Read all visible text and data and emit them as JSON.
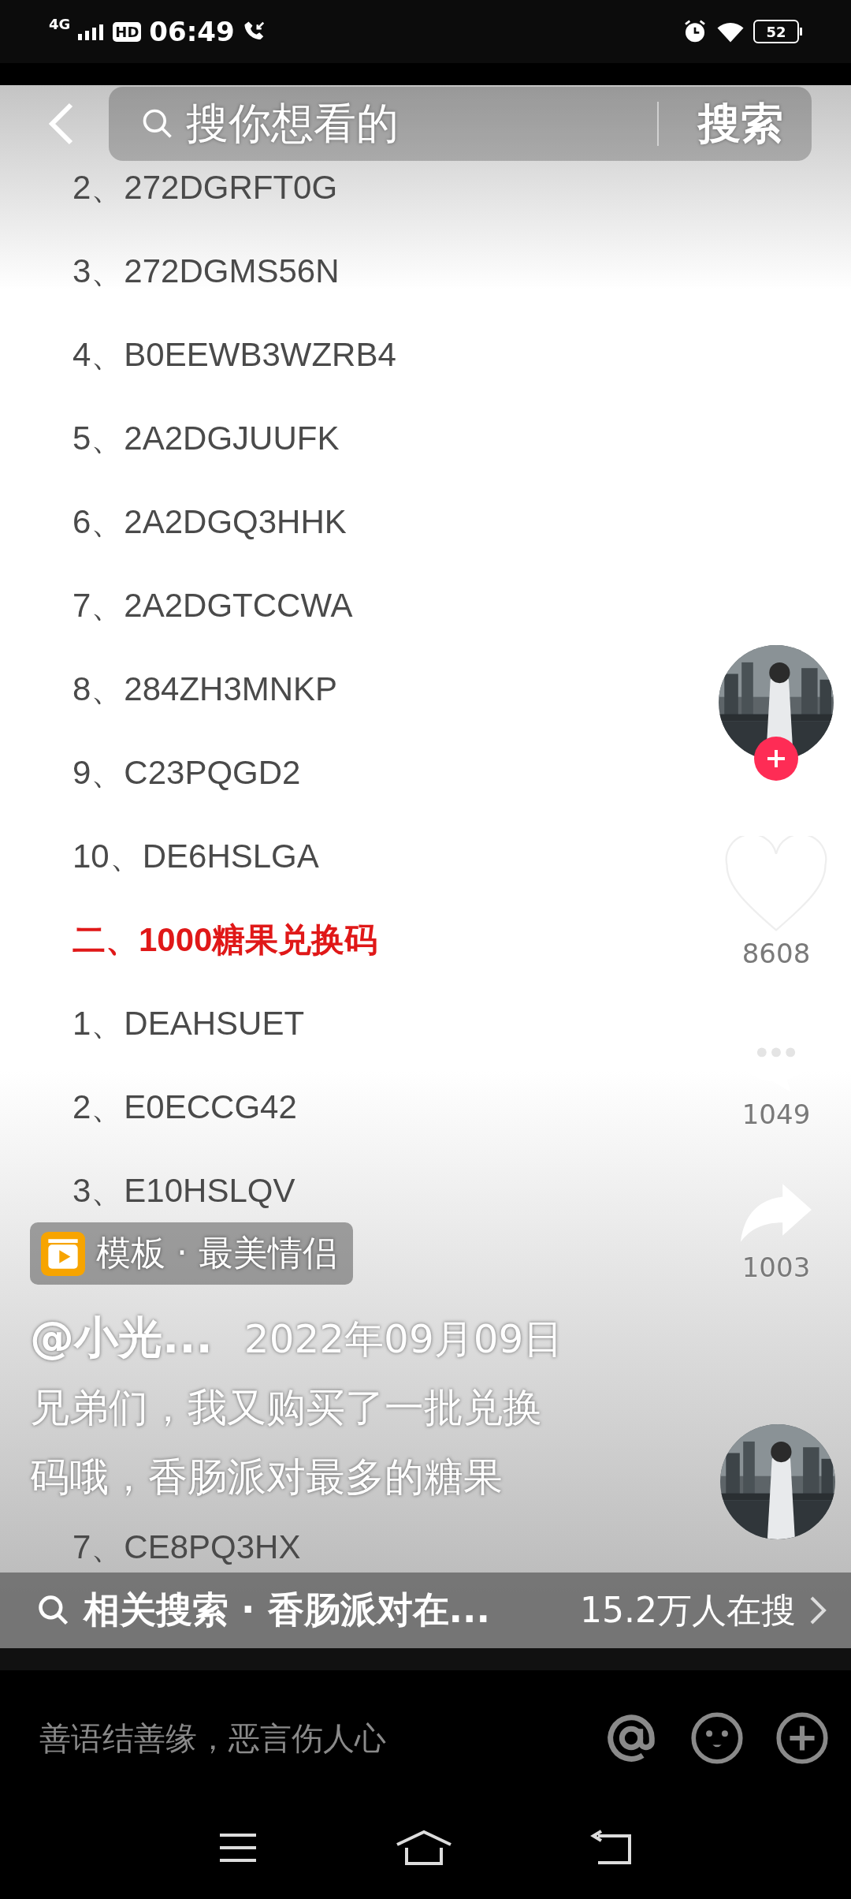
{
  "status_bar": {
    "network": "4G",
    "hd": "HD",
    "time": "06:49",
    "battery": "52"
  },
  "search": {
    "placeholder": "搜你想看的",
    "button": "搜索"
  },
  "video_document": {
    "items": [
      "2、272DGRFT0G",
      "3、272DGMS56N",
      "4、B0EEWB3WZRB4",
      "5、2A2DGJUUFK",
      "6、2A2DGQ3HHK",
      "7、2A2DGTCCWA",
      "8、284ZH3MNKP",
      "9、C23PQGD2",
      "10、DE6HSLGA"
    ],
    "heading": "二、1000糖果兑换码",
    "items_2": [
      "1、DEAHSUET",
      "2、E0ECCG42",
      "3、E10HSLQV"
    ],
    "items_2_lower": [
      "7、CE8PQ3HX"
    ]
  },
  "actions": {
    "follow": {
      "followed": false
    },
    "likes": "8608",
    "comments": "1049",
    "shares": "1003"
  },
  "template_tag": "模板 · 最美情侣",
  "author": "@小光...",
  "date": "2022年09月09日",
  "caption": "兄弟们，我又购买了一批兑换码哦，香肠派对最多的糖果",
  "related_search": {
    "label": "相关搜索 · 香肠派对在...",
    "count": "15.2万人在搜"
  },
  "comment_bar": {
    "placeholder": "善语结善缘，恶言伤人心"
  }
}
